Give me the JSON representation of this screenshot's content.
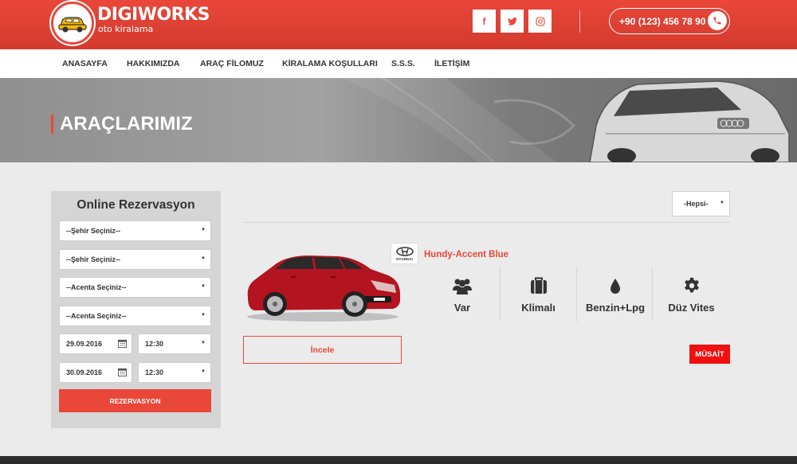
{
  "brand": {
    "name": "DIGIWORKS",
    "subtitle": "oto kiralama"
  },
  "social": [
    {
      "icon": "facebook-icon",
      "glyph": "f"
    },
    {
      "icon": "twitter-icon",
      "glyph": "t"
    },
    {
      "icon": "instagram-icon",
      "glyph": "◎"
    }
  ],
  "phone": {
    "number": "+90 (123) 456 78 90"
  },
  "nav": [
    "ANASAYFA",
    "HAKKIMIZDA",
    "ARAÇ FİLOMUZ",
    "KİRALAMA KOŞULLARI",
    "S.S.S.",
    "İLETİŞİM"
  ],
  "banner": {
    "title": "ARAÇLARIMIZ"
  },
  "reservation": {
    "title": "Online Rezervasyon",
    "city_pickup": "--Şehir Seçiniz--",
    "city_return": "--Şehir Seçiniz--",
    "agency_pickup": "--Acenta Seçiniz--",
    "agency_return": "--Acenta Seçiniz--",
    "date_pickup": "29.09.2016",
    "time_pickup": "12:30",
    "date_return": "30.09.2016",
    "time_return": "12:30",
    "submit_label": "REZERVASYON"
  },
  "filter": {
    "selected": "-Hepsi-"
  },
  "car": {
    "brand_logo_text": "HYUNDAI",
    "name": "Hundy-Accent Blue",
    "features": [
      {
        "icon": "users-icon",
        "label": "Var"
      },
      {
        "icon": "luggage-icon",
        "label": "Klimalı"
      },
      {
        "icon": "fuel-drop-icon",
        "label": "Benzin+Lpg"
      },
      {
        "icon": "gear-icon",
        "label": "Düz Vites"
      }
    ],
    "details_label": "İncele",
    "status": "MÜSAİT"
  },
  "colors": {
    "accent": "#e9473a",
    "status_red": "#f20f0f",
    "car_red": "#b3141f"
  }
}
